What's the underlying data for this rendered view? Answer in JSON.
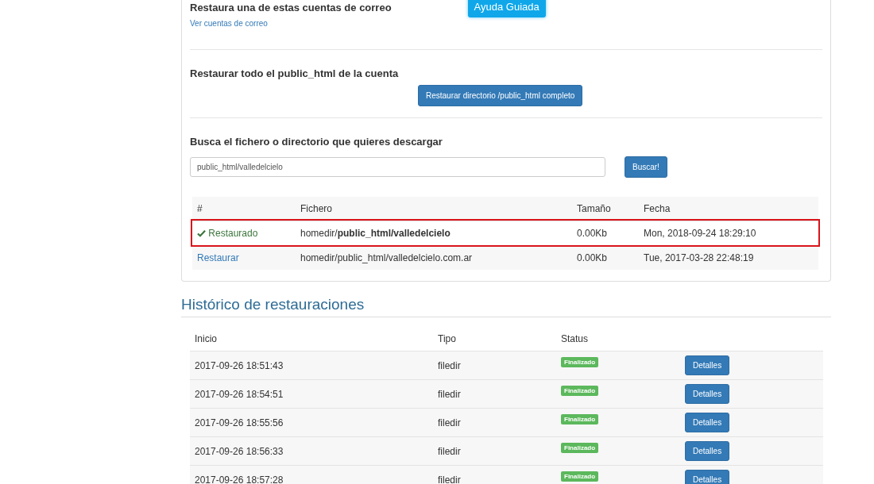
{
  "mail_section": {
    "title": "Restaura una de estas cuentas de correo",
    "link": "Ver cuentas de correo",
    "help_button": "Ayuda Guiada"
  },
  "public_html_section": {
    "title": "Restaurar todo el public_html de la cuenta",
    "button": "Restaurar directorio /public_html completo"
  },
  "search_section": {
    "title": "Busca el fichero o directorio que quieres descargar",
    "field_value": "public_html/valledelcielo",
    "button": "Buscar!"
  },
  "files_table": {
    "columns": [
      "#",
      "Fichero",
      "Tamaño",
      "Fecha"
    ],
    "rows": [
      {
        "kind": "restored",
        "action": "Restaurado",
        "file": "homedir/**public_html/valledelcielo**",
        "size": "0.00Kb",
        "date": "Mon, 2018-09-24 18:29:10",
        "highlighted": true
      },
      {
        "kind": "link",
        "action": "Restaurar",
        "file": "homedir/public_html/valledelcielo.com.ar",
        "size": "0.00Kb",
        "date": "Tue, 2017-03-28 22:48:19",
        "highlighted": false
      }
    ]
  },
  "history": {
    "title": "Histórico de restauraciones",
    "columns": [
      "Inicio",
      "Tipo",
      "Status"
    ],
    "rows": [
      {
        "start": "2017-09-26 18:51:43",
        "type": "filedir",
        "status": "Finalizado",
        "button": "Detalles"
      },
      {
        "start": "2017-09-26 18:54:51",
        "type": "filedir",
        "status": "Finalizado",
        "button": "Detalles"
      },
      {
        "start": "2017-09-26 18:55:56",
        "type": "filedir",
        "status": "Finalizado",
        "button": "Detalles"
      },
      {
        "start": "2017-09-26 18:56:33",
        "type": "filedir",
        "status": "Finalizado",
        "button": "Detalles"
      },
      {
        "start": "2017-09-26 18:57:28",
        "type": "filedir",
        "status": "Finalizado",
        "button": "Detalles"
      }
    ]
  }
}
